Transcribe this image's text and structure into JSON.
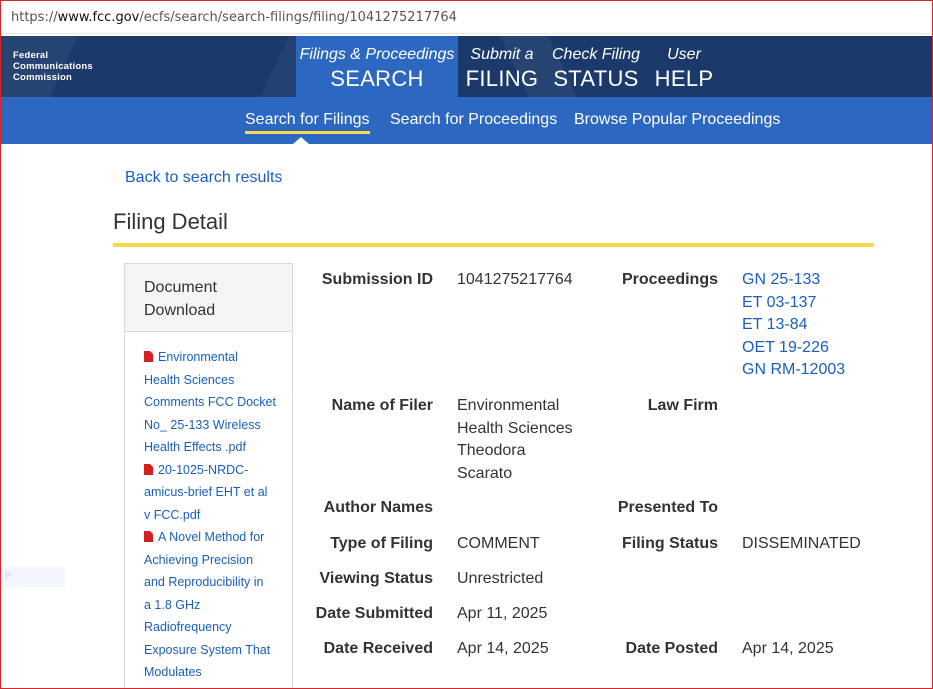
{
  "url": {
    "prefix": "https://",
    "host": "www.fcc.gov",
    "path": "/ecfs/search/search-filings/filing/1041275217764"
  },
  "logo": {
    "line1": "Federal",
    "line2": "Communications",
    "line3": "Commission"
  },
  "nav": [
    {
      "small": "Filings & Proceedings",
      "big": "SEARCH"
    },
    {
      "small": "Submit a",
      "big": "FILING"
    },
    {
      "small": "Check Filing",
      "big": "STATUS"
    },
    {
      "small": "User",
      "big": "HELP"
    }
  ],
  "subnav": [
    "Search for Filings",
    "Search for Proceedings",
    "Browse Popular Proceedings"
  ],
  "back_link": "Back to search results",
  "page_title": "Filing Detail",
  "sidebar": {
    "heading_line1": "Document",
    "heading_line2": "Download",
    "docs": [
      [
        "Environmental",
        "Health Sciences",
        "Comments FCC Docket",
        "No_ 25-133 Wireless",
        "Health Effects .pdf"
      ],
      [
        "20-1025-NRDC-",
        "amicus-brief EHT et al",
        "v FCC.pdf"
      ],
      [
        "A Novel Method for",
        "Achieving Precision",
        "and Reproducibility in",
        "a 1.8 GHz",
        "Radiofrequency",
        "Exposure System That",
        "Modulates"
      ]
    ]
  },
  "fields": {
    "submission_id": {
      "label": "Submission ID",
      "value": "1041275217764"
    },
    "proceedings": {
      "label": "Proceedings",
      "values": [
        "GN 25-133",
        "ET 03-137",
        "ET 13-84",
        "OET 19-226",
        "GN RM-12003"
      ]
    },
    "name_of_filer": {
      "label": "Name of Filer",
      "values": [
        "Environmental",
        "Health Sciences",
        "Theodora",
        "Scarato"
      ]
    },
    "law_firm": {
      "label": "Law Firm",
      "value": ""
    },
    "author_names": {
      "label": "Author Names",
      "value": ""
    },
    "presented_to": {
      "label": "Presented To",
      "value": ""
    },
    "type_of_filing": {
      "label": "Type of Filing",
      "value": "COMMENT"
    },
    "filing_status": {
      "label": "Filing Status",
      "value": "DISSEMINATED"
    },
    "viewing_status": {
      "label": "Viewing Status",
      "value": "Unrestricted"
    },
    "date_submitted": {
      "label": "Date Submitted",
      "value": "Apr 11, 2025"
    },
    "date_received": {
      "label": "Date Received",
      "value": "Apr 14, 2025"
    },
    "date_posted": {
      "label": "Date Posted",
      "value": "Apr 14, 2025"
    }
  },
  "colors": {
    "header_dark": "#1b3a6b",
    "header_blue": "#2c67c1",
    "accent_yellow": "#f7d74c",
    "link": "#1a5fbe"
  }
}
